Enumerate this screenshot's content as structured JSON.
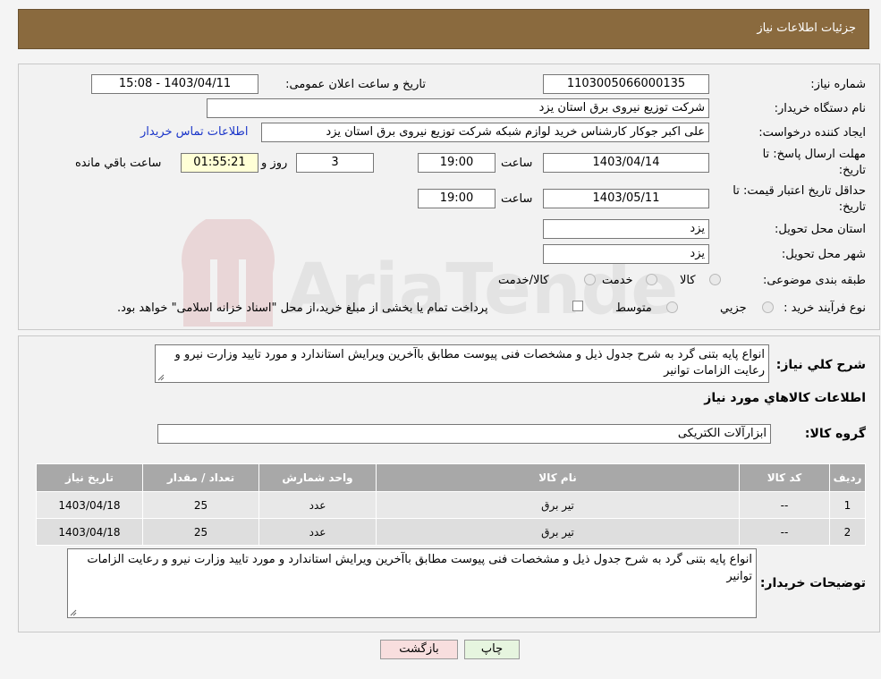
{
  "header": {
    "title": "جزئیات اطلاعات نیاز"
  },
  "form": {
    "need_number_label": "شماره نیاز:",
    "need_number": "1103005066000135",
    "announce_label": "تاریخ و ساعت اعلان عمومی:",
    "announce_value": "1403/04/11 - 15:08",
    "buyer_org_label": "نام دستگاه خریدار:",
    "buyer_org": "شرکت توزیع نیروی برق استان یزد",
    "requester_label": "ایجاد کننده درخواست:",
    "requester": "علی اکبر  جوکار  کارشناس خرید لوازم شبکه  شرکت توزیع نیروی برق استان یزد",
    "contact_link": "اطلاعات تماس خریدار",
    "deadline_label_1": "مهلت ارسال پاسخ: تا",
    "deadline_label_2": "تاریخ:",
    "deadline_date": "1403/04/14",
    "time_label": "ساعت",
    "deadline_time": "19:00",
    "days_value": "3",
    "days_label": "روز و",
    "remaining_time": "01:55:21",
    "remaining_label": "ساعت باقي مانده",
    "validity_label_1": "حداقل تاریخ اعتبار قیمت: تا",
    "validity_label_2": "تاریخ:",
    "validity_date": "1403/05/11",
    "validity_time": "19:00",
    "province_label": "استان محل تحویل:",
    "province": "یزد",
    "city_label": "شهر محل تحویل:",
    "city": "یزد",
    "category_label": "طبقه بندی موضوعی:",
    "category_options": [
      "کالا",
      "خدمت",
      "کالا/خدمت"
    ],
    "process_label": "نوع فرآیند خرید :",
    "process_options": [
      "جزیي",
      "متوسط"
    ],
    "payment_note": "پرداخت تمام یا بخشی از مبلغ خرید،از محل \"اسناد خزانه اسلامی\" خواهد بود."
  },
  "description": {
    "label": "شرح کلي نیاز:",
    "text": "انواع پایه بتنی گرد به شرح جدول ذیل و مشخصات فنی  پیوست مطابق باآخرین ویرایش استاندارد و مورد تایید وزارت نیرو و رعایت الزامات توانیر"
  },
  "goods": {
    "section_title": "اطلاعات کالاهاي مورد نیاز",
    "group_label": "گروه کالا:",
    "group_value": "ابزارآلات الکتریکی",
    "columns": [
      "ردیف",
      "کد کالا",
      "نام کالا",
      "واحد شمارش",
      "تعداد / مقدار",
      "تاریخ نیاز"
    ],
    "rows": [
      [
        "1",
        "--",
        "تیر برق",
        "عدد",
        "25",
        "1403/04/18"
      ],
      [
        "2",
        "--",
        "تیر برق",
        "عدد",
        "25",
        "1403/04/18"
      ]
    ]
  },
  "buyer_notes": {
    "label": "توضیحات خریدار:",
    "text": "انواع پایه بتنی گرد به شرح جدول ذیل و مشخصات فنی  پیوست مطابق باآخرین ویرایش استاندارد و مورد تایید وزارت نیرو و رعایت الزامات توانیر"
  },
  "buttons": {
    "print": "چاپ",
    "back": "بازگشت"
  },
  "watermark": {
    "text": "AriaTender.neT"
  },
  "colors": {
    "header_bg": "#8a6a3e",
    "link": "#1a35c9",
    "back_button_bg": "#f8dede",
    "print_button_bg": "#e6f5df"
  }
}
